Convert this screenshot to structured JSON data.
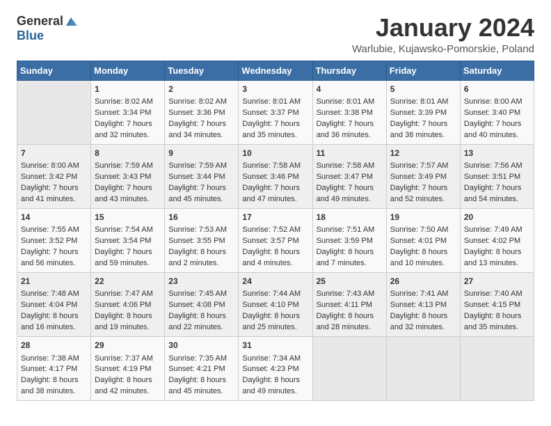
{
  "logo": {
    "general": "General",
    "blue": "Blue"
  },
  "title": "January 2024",
  "location": "Warlubie, Kujawsko-Pomorskie, Poland",
  "days_of_week": [
    "Sunday",
    "Monday",
    "Tuesday",
    "Wednesday",
    "Thursday",
    "Friday",
    "Saturday"
  ],
  "weeks": [
    [
      {
        "day": "",
        "content": ""
      },
      {
        "day": "1",
        "content": "Sunrise: 8:02 AM\nSunset: 3:34 PM\nDaylight: 7 hours\nand 32 minutes."
      },
      {
        "day": "2",
        "content": "Sunrise: 8:02 AM\nSunset: 3:36 PM\nDaylight: 7 hours\nand 34 minutes."
      },
      {
        "day": "3",
        "content": "Sunrise: 8:01 AM\nSunset: 3:37 PM\nDaylight: 7 hours\nand 35 minutes."
      },
      {
        "day": "4",
        "content": "Sunrise: 8:01 AM\nSunset: 3:38 PM\nDaylight: 7 hours\nand 36 minutes."
      },
      {
        "day": "5",
        "content": "Sunrise: 8:01 AM\nSunset: 3:39 PM\nDaylight: 7 hours\nand 38 minutes."
      },
      {
        "day": "6",
        "content": "Sunrise: 8:00 AM\nSunset: 3:40 PM\nDaylight: 7 hours\nand 40 minutes."
      }
    ],
    [
      {
        "day": "7",
        "content": "Sunrise: 8:00 AM\nSunset: 3:42 PM\nDaylight: 7 hours\nand 41 minutes."
      },
      {
        "day": "8",
        "content": "Sunrise: 7:59 AM\nSunset: 3:43 PM\nDaylight: 7 hours\nand 43 minutes."
      },
      {
        "day": "9",
        "content": "Sunrise: 7:59 AM\nSunset: 3:44 PM\nDaylight: 7 hours\nand 45 minutes."
      },
      {
        "day": "10",
        "content": "Sunrise: 7:58 AM\nSunset: 3:46 PM\nDaylight: 7 hours\nand 47 minutes."
      },
      {
        "day": "11",
        "content": "Sunrise: 7:58 AM\nSunset: 3:47 PM\nDaylight: 7 hours\nand 49 minutes."
      },
      {
        "day": "12",
        "content": "Sunrise: 7:57 AM\nSunset: 3:49 PM\nDaylight: 7 hours\nand 52 minutes."
      },
      {
        "day": "13",
        "content": "Sunrise: 7:56 AM\nSunset: 3:51 PM\nDaylight: 7 hours\nand 54 minutes."
      }
    ],
    [
      {
        "day": "14",
        "content": "Sunrise: 7:55 AM\nSunset: 3:52 PM\nDaylight: 7 hours\nand 56 minutes."
      },
      {
        "day": "15",
        "content": "Sunrise: 7:54 AM\nSunset: 3:54 PM\nDaylight: 7 hours\nand 59 minutes."
      },
      {
        "day": "16",
        "content": "Sunrise: 7:53 AM\nSunset: 3:55 PM\nDaylight: 8 hours\nand 2 minutes."
      },
      {
        "day": "17",
        "content": "Sunrise: 7:52 AM\nSunset: 3:57 PM\nDaylight: 8 hours\nand 4 minutes."
      },
      {
        "day": "18",
        "content": "Sunrise: 7:51 AM\nSunset: 3:59 PM\nDaylight: 8 hours\nand 7 minutes."
      },
      {
        "day": "19",
        "content": "Sunrise: 7:50 AM\nSunset: 4:01 PM\nDaylight: 8 hours\nand 10 minutes."
      },
      {
        "day": "20",
        "content": "Sunrise: 7:49 AM\nSunset: 4:02 PM\nDaylight: 8 hours\nand 13 minutes."
      }
    ],
    [
      {
        "day": "21",
        "content": "Sunrise: 7:48 AM\nSunset: 4:04 PM\nDaylight: 8 hours\nand 16 minutes."
      },
      {
        "day": "22",
        "content": "Sunrise: 7:47 AM\nSunset: 4:06 PM\nDaylight: 8 hours\nand 19 minutes."
      },
      {
        "day": "23",
        "content": "Sunrise: 7:45 AM\nSunset: 4:08 PM\nDaylight: 8 hours\nand 22 minutes."
      },
      {
        "day": "24",
        "content": "Sunrise: 7:44 AM\nSunset: 4:10 PM\nDaylight: 8 hours\nand 25 minutes."
      },
      {
        "day": "25",
        "content": "Sunrise: 7:43 AM\nSunset: 4:11 PM\nDaylight: 8 hours\nand 28 minutes."
      },
      {
        "day": "26",
        "content": "Sunrise: 7:41 AM\nSunset: 4:13 PM\nDaylight: 8 hours\nand 32 minutes."
      },
      {
        "day": "27",
        "content": "Sunrise: 7:40 AM\nSunset: 4:15 PM\nDaylight: 8 hours\nand 35 minutes."
      }
    ],
    [
      {
        "day": "28",
        "content": "Sunrise: 7:38 AM\nSunset: 4:17 PM\nDaylight: 8 hours\nand 38 minutes."
      },
      {
        "day": "29",
        "content": "Sunrise: 7:37 AM\nSunset: 4:19 PM\nDaylight: 8 hours\nand 42 minutes."
      },
      {
        "day": "30",
        "content": "Sunrise: 7:35 AM\nSunset: 4:21 PM\nDaylight: 8 hours\nand 45 minutes."
      },
      {
        "day": "31",
        "content": "Sunrise: 7:34 AM\nSunset: 4:23 PM\nDaylight: 8 hours\nand 49 minutes."
      },
      {
        "day": "",
        "content": ""
      },
      {
        "day": "",
        "content": ""
      },
      {
        "day": "",
        "content": ""
      }
    ]
  ]
}
